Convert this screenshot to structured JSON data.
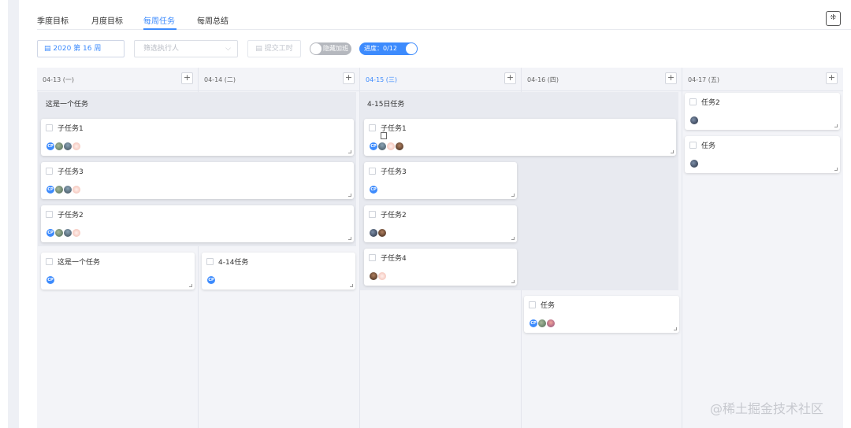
{
  "tabs": [
    {
      "label": "季度目标",
      "active": false
    },
    {
      "label": "月度目标",
      "active": false
    },
    {
      "label": "每周任务",
      "active": true
    },
    {
      "label": "每周总结",
      "active": false
    }
  ],
  "toolbar": {
    "week_label": "2020 第 16 周",
    "executor_placeholder": "筛选执行人",
    "submit_hours_label": "提交工时",
    "hide_toggle_label": "隐藏加班",
    "progress_toggle_label": "进度：0/12"
  },
  "columns": [
    {
      "date": "04-13 (一)",
      "today": false
    },
    {
      "date": "04-14 (二)",
      "today": false
    },
    {
      "date": "04-15 (三)",
      "today": true
    },
    {
      "date": "04-16 (四)",
      "today": false
    },
    {
      "date": "04-17 (五)",
      "today": false
    }
  ],
  "groups": [
    {
      "title": "这是一个任务",
      "subtasks": [
        "子任务1",
        "子任务3",
        "子任务2"
      ]
    },
    {
      "title": "4-15日任务",
      "subtasks": [
        "子任务1",
        "子任务3",
        "子任务2",
        "子任务4"
      ]
    }
  ],
  "cards": {
    "mon_standalone": "这是一个任务",
    "tue_standalone": "4-14任务",
    "thu_task": "任务",
    "fri_task1": "任务2",
    "fri_task2": "任务"
  },
  "avatar_text": "CP",
  "colors": {
    "accent": "#3d8bfd",
    "board_bg": "#f3f4f8",
    "group_bg": "#e8eaf0"
  },
  "watermark": "@稀土掘金技术社区"
}
